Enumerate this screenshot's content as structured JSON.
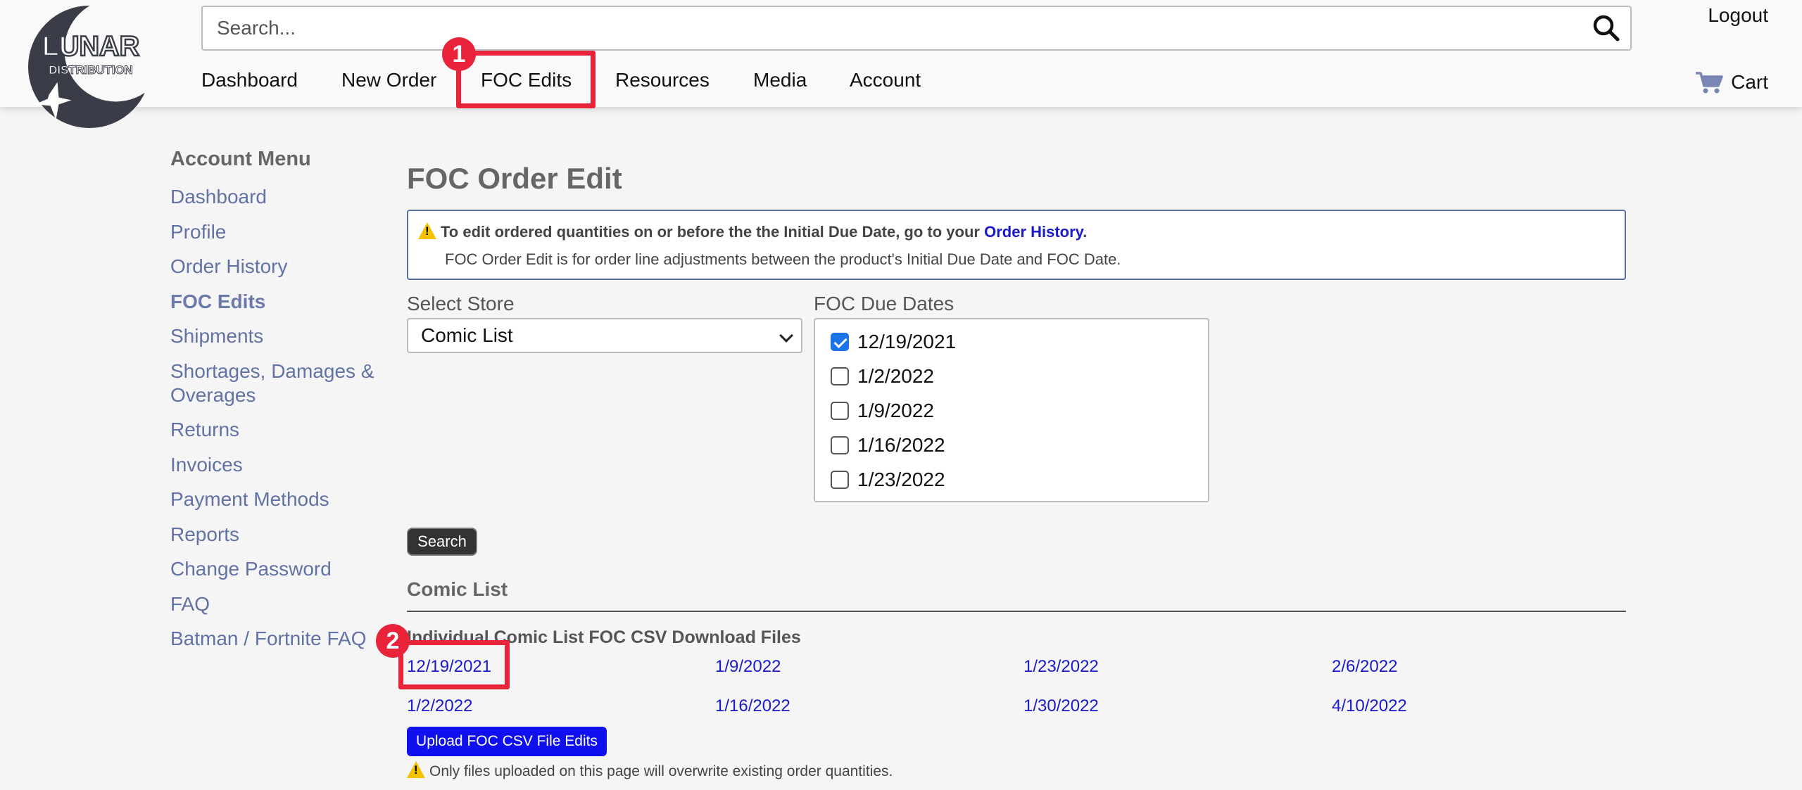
{
  "header": {
    "logo_text": "LUNAR DISTRIBUTION",
    "search_placeholder": "Search...",
    "logout": "Logout",
    "cart": "Cart",
    "nav": [
      "Dashboard",
      "New Order",
      "FOC Edits",
      "Resources",
      "Media",
      "Account"
    ]
  },
  "annotations": [
    "1",
    "2"
  ],
  "sidebar": {
    "title": "Account Menu",
    "items": [
      "Dashboard",
      "Profile",
      "Order History",
      "FOC Edits",
      "Shipments",
      "Shortages, Damages & Overages",
      "Returns",
      "Invoices",
      "Payment Methods",
      "Reports",
      "Change Password",
      "FAQ",
      "Batman / Fortnite FAQ"
    ]
  },
  "main": {
    "title": "FOC Order Edit",
    "notice": {
      "line1_prefix": "To edit ordered quantities on or before the the Initial Due Date, go to your ",
      "line1_link": "Order History",
      "line1_suffix": ".",
      "line2": "FOC Order Edit is for order line adjustments between the product's Initial Due Date and FOC Date."
    },
    "select_store_label": "Select Store",
    "select_store_value": "Comic List",
    "foc_due_dates_label": "FOC Due Dates",
    "foc_due_dates": [
      {
        "label": "12/19/2021",
        "checked": true
      },
      {
        "label": "1/2/2022",
        "checked": false
      },
      {
        "label": "1/9/2022",
        "checked": false
      },
      {
        "label": "1/16/2022",
        "checked": false
      },
      {
        "label": "1/23/2022",
        "checked": false
      }
    ],
    "search_button": "Search",
    "section_title": "Comic List",
    "download_title": "Individual Comic List FOC CSV Download Files",
    "download_links": [
      "12/19/2021",
      "1/9/2022",
      "1/23/2022",
      "2/6/2022",
      "1/2/2022",
      "1/16/2022",
      "1/30/2022",
      "4/10/2022"
    ],
    "upload_button": "Upload FOC CSV File Edits",
    "note": "Only files uploaded on this page will overwrite existing order quantities."
  },
  "colors": {
    "annotation_red": "#e8233a",
    "link_blue": "#1a1acc",
    "sidebar_link": "#6272a4",
    "upload_button": "#1010ee"
  }
}
